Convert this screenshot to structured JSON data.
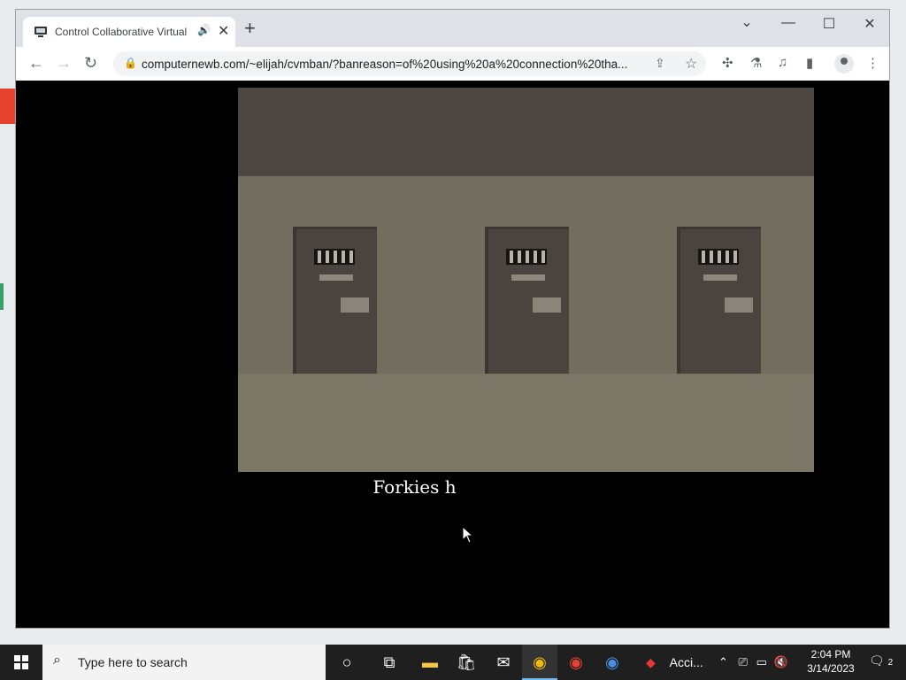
{
  "browser": {
    "tab": {
      "title": "Control Collaborative Virtual",
      "audio_icon": "speaker-icon",
      "close_glyph": "✕"
    },
    "new_tab_glyph": "+",
    "window_controls": {
      "tab_search": "⌄",
      "minimize": "—",
      "maximize": "☐",
      "close": "✕"
    },
    "nav": {
      "back": "←",
      "forward": "→",
      "reload": "↻"
    },
    "address_bar": {
      "url": "computernewb.com/~elijah/cvmban/?banreason=of%20using%20a%20connection%20tha..."
    }
  },
  "page": {
    "caption": "Forkies h"
  },
  "taskbar": {
    "search_placeholder": "Type here to search",
    "pinned_app_label": "Acci...",
    "clock": {
      "time": "2:04 PM",
      "date": "3/14/2023"
    },
    "notification_count": "2"
  },
  "colors": {
    "window_bg": "#000000",
    "ceiling": "#4d4743",
    "wall": "#716e60",
    "floor": "#7a7766",
    "door": "#4a433e",
    "taskbar": "#1f1f1f"
  }
}
